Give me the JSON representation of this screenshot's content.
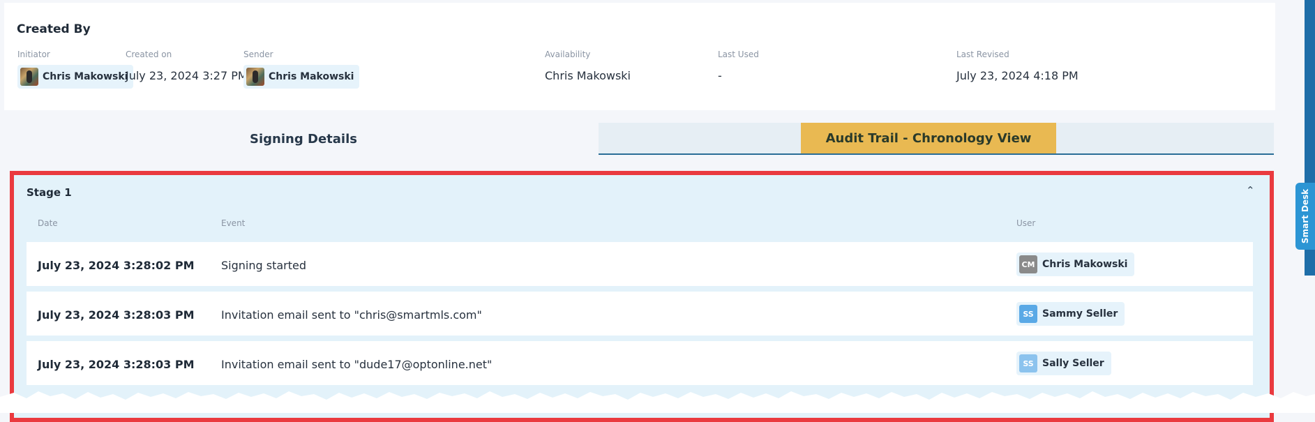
{
  "created_by": {
    "title": "Created By",
    "initiator": {
      "label": "Initiator",
      "name": "Chris Makowski"
    },
    "created_on": {
      "label": "Created on",
      "value": "July 23, 2024 3:27 PM"
    },
    "sender": {
      "label": "Sender",
      "name": "Chris Makowski"
    },
    "availability": {
      "label": "Availability",
      "value": "Chris Makowski"
    },
    "last_used": {
      "label": "Last Used",
      "value": "-"
    },
    "last_revised": {
      "label": "Last Revised",
      "value": "July 23, 2024 4:18 PM"
    }
  },
  "tabs": {
    "signing_details": "Signing Details",
    "audit_trail": "Audit Trail - Chronology View"
  },
  "stage": {
    "title": "Stage 1",
    "columns": {
      "date": "Date",
      "event": "Event",
      "user": "User"
    },
    "rows": [
      {
        "date": "July 23, 2024 3:28:02 PM",
        "event": "Signing started",
        "user_initials": "CM",
        "user_name": "Chris Makowski",
        "avatar_color": "#8a8a8a"
      },
      {
        "date": "July 23, 2024 3:28:03 PM",
        "event": "Invitation email sent to \"chris@smartmls.com\"",
        "user_initials": "SS",
        "user_name": "Sammy Seller",
        "avatar_color": "#5aa9e6"
      },
      {
        "date": "July 23, 2024 3:28:03 PM",
        "event": "Invitation email sent to \"dude17@optonline.net\"",
        "user_initials": "SS",
        "user_name": "Sally Seller",
        "avatar_color": "#8cc3ee"
      }
    ]
  },
  "smart_desk": {
    "label": "Smart Desk"
  },
  "colors": {
    "accent_tab": "#e9b952",
    "highlight_frame": "#ea3a3f",
    "smart_desk": "#2c95d4"
  }
}
